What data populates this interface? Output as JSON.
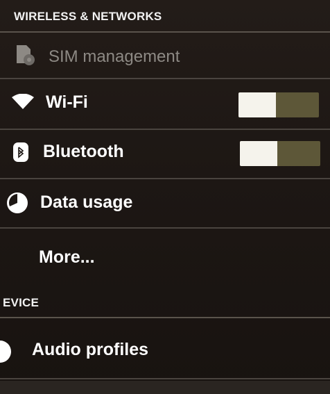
{
  "sections": {
    "wireless_header": "WIRELESS & NETWORKS",
    "device_header": "EVICE"
  },
  "items": {
    "sim": {
      "label": "SIM management",
      "icon": "sim-card-icon"
    },
    "wifi": {
      "label": "Wi-Fi",
      "icon": "wifi-icon",
      "toggle_state": "on"
    },
    "bluetooth": {
      "label": "Bluetooth",
      "icon": "bluetooth-icon",
      "toggle_state": "on"
    },
    "data_usage": {
      "label": "Data usage",
      "icon": "data-usage-icon"
    },
    "more": {
      "label": "More..."
    },
    "audio": {
      "label": "Audio profiles",
      "icon": "audio-profiles-icon"
    }
  },
  "colors": {
    "background": "#1d1714",
    "divider": "#5a534c",
    "toggle_track": "#5d5738",
    "toggle_knob": "#f5f3ec",
    "disabled_text": "#8d8984"
  }
}
